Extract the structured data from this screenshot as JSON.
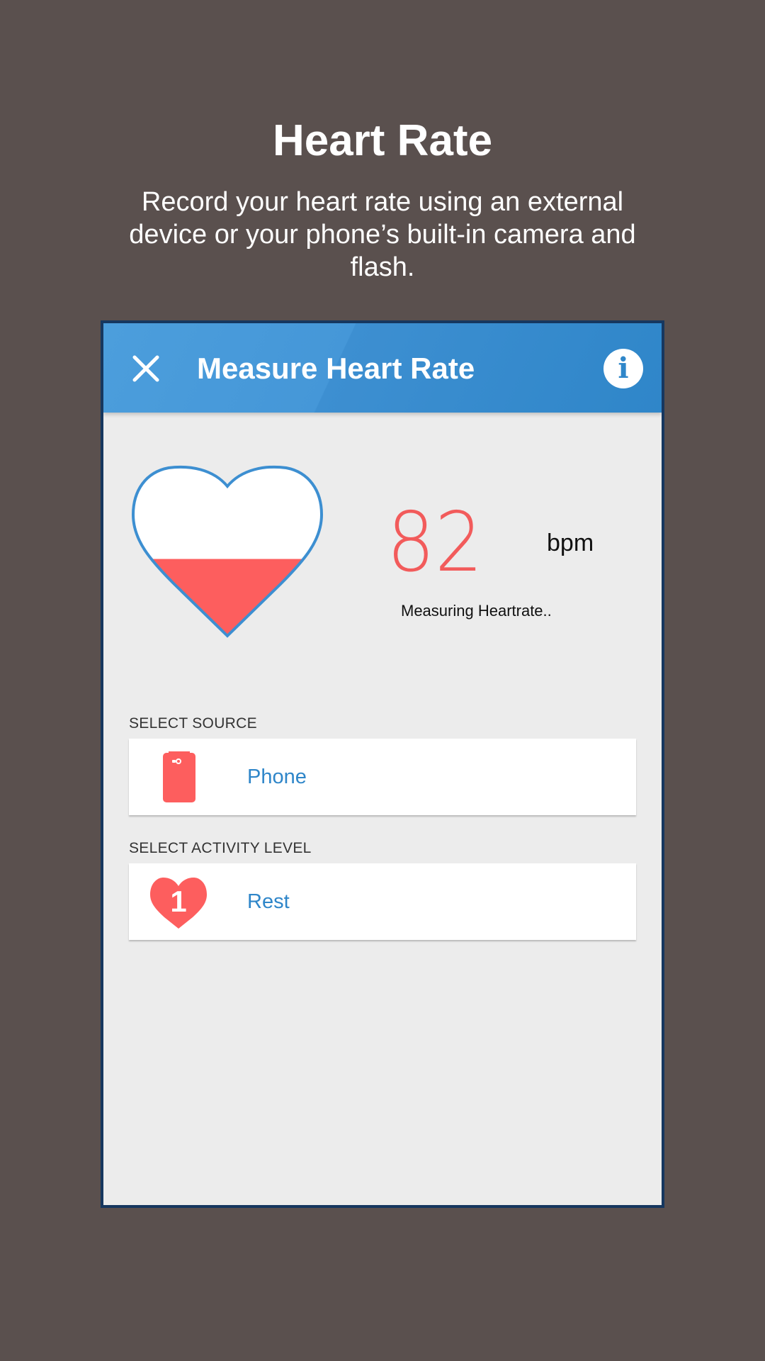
{
  "promo": {
    "title": "Heart Rate",
    "subtitle": "Record your heart rate using an external device or your phone’s built-in camera and flash."
  },
  "app_bar": {
    "title": "Measure Heart Rate",
    "close_icon": "close-icon",
    "info_icon": "info-icon",
    "info_glyph": "i",
    "color": "#3d8fd1"
  },
  "measurement": {
    "value": "82",
    "unit": "bpm",
    "status": "Measuring Heartrate..",
    "fill_fraction": 0.45,
    "fill_color": "#fd5e5e",
    "outline_color": "#3d8fd1"
  },
  "source": {
    "label": "SELECT SOURCE",
    "value": "Phone",
    "icon": "phone-icon"
  },
  "activity": {
    "label": "SELECT ACTIVITY LEVEL",
    "value": "Rest",
    "level": "1",
    "icon": "heart-level-icon"
  }
}
